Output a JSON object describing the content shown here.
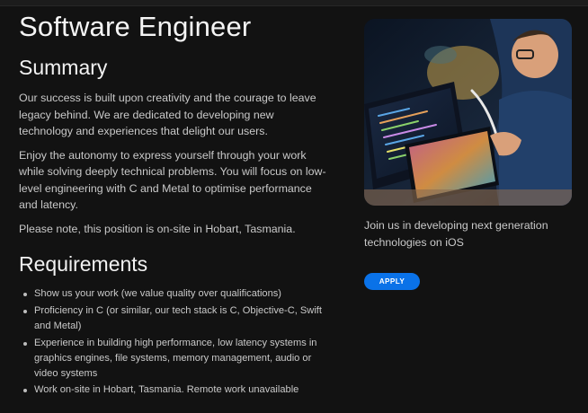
{
  "job": {
    "title": "Software Engineer"
  },
  "summary": {
    "heading": "Summary",
    "paragraphs": [
      "Our success is built upon creativity and the courage to leave legacy behind. We are dedicated to developing new technology and experiences that delight our users.",
      "Enjoy the autonomy to express yourself through your work while solving deeply technical problems. You will focus on low-level engineering with C and Metal to optimise performance and latency.",
      "Please note, this position is on-site in Hobart, Tasmania."
    ]
  },
  "requirements": {
    "heading": "Requirements",
    "items": [
      "Show us your work (we value quality over qualifications)",
      "Proficiency in C (or similar, our tech stack is C, Objective-C, Swift and Metal)",
      "Experience in building high performance, low latency systems in graphics engines, file systems, memory management, audio or video systems",
      "Work on-site in Hobart, Tasmania. Remote work unavailable"
    ]
  },
  "sidebar": {
    "tagline": "Join us in developing next generation technologies on iOS",
    "apply_label": "APPLY"
  },
  "colors": {
    "background": "#121212",
    "accent": "#0a72e8"
  }
}
